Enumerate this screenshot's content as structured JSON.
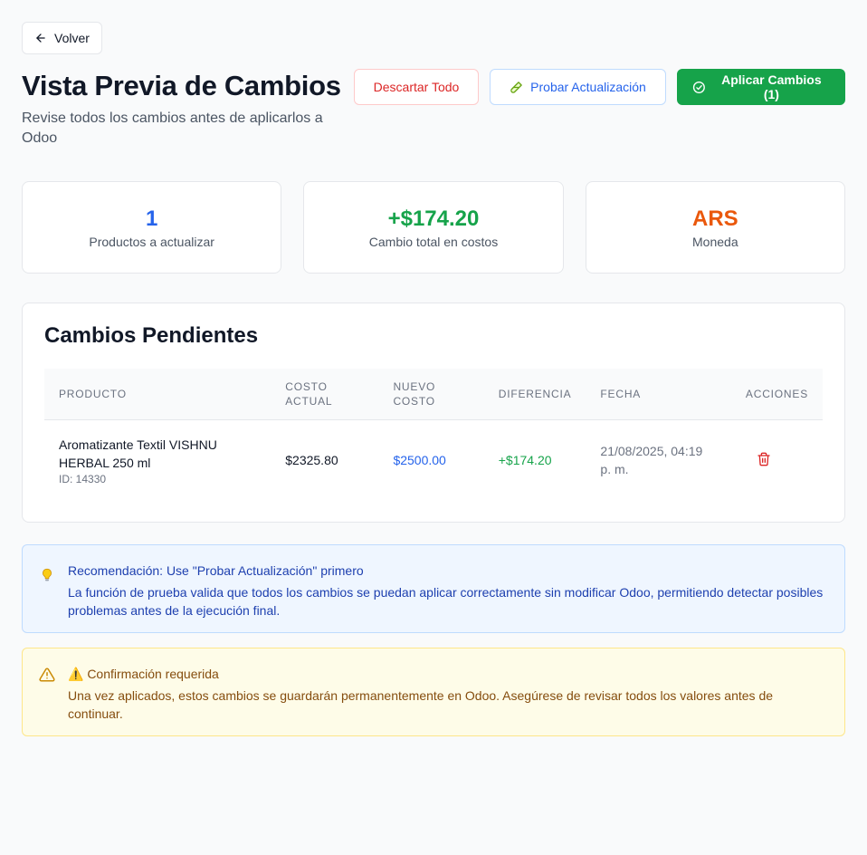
{
  "nav": {
    "back_label": "Volver"
  },
  "header": {
    "title": "Vista Previa de Cambios",
    "subtitle": "Revise todos los cambios antes de aplicarlos a Odoo"
  },
  "actions": {
    "discard_label": "Descartar Todo",
    "test_label": "Probar Actualización",
    "apply_label": "Aplicar Cambios (1)"
  },
  "stats": [
    {
      "value": "1",
      "label": "Productos a actualizar",
      "color": "#2563eb"
    },
    {
      "value": "+$174.20",
      "label": "Cambio total en costos",
      "color": "#16a34a"
    },
    {
      "value": "ARS",
      "label": "Moneda",
      "color": "#ea580c"
    }
  ],
  "changes": {
    "title": "Cambios Pendientes",
    "columns": {
      "product": "PRODUCTO",
      "current_cost_1": "COSTO",
      "current_cost_2": "ACTUAL",
      "new_cost_1": "NUEVO",
      "new_cost_2": "COSTO",
      "difference": "DIFERENCIA",
      "date": "FECHA",
      "actions": "ACCIONES"
    },
    "rows": [
      {
        "product_line1": "Aromatizante Textil VISHNU",
        "product_line2": "HERBAL 250 ml",
        "product_id": "ID: 14330",
        "current_cost": "$2325.80",
        "new_cost": "$2500.00",
        "difference": "+$174.20",
        "date_line1": "21/08/2025, 04:19",
        "date_line2": "p. m.",
        "delete_icon": "trash-icon"
      }
    ]
  },
  "recommendation": {
    "icon": "lightbulb-icon",
    "title": "Recomendación: Use \"Probar Actualización\" primero",
    "text": "La función de prueba valida que todos los cambios se puedan aplicar correctamente sin modificar Odoo, permitiendo detectar posibles problemas antes de la ejecución final."
  },
  "confirmation": {
    "icon": "warning-triangle-icon",
    "title": "⚠️ Confirmación requerida",
    "text": "Una vez aplicados, estos cambios se guardarán permanentemente en Odoo. Asegúrese de revisar todos los valores antes de continuar."
  }
}
